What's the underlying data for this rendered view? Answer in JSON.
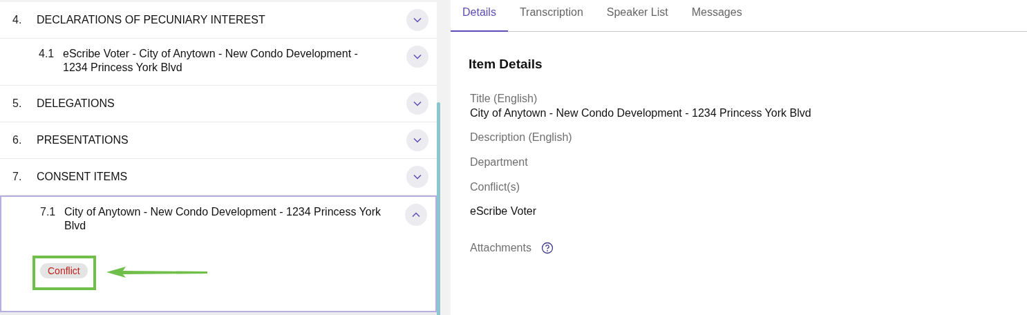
{
  "agenda": [
    {
      "number": "4.",
      "title": "DECLARATIONS OF PECUNIARY INTEREST",
      "expanded": false,
      "selected": false,
      "children": [
        {
          "number": "4.1",
          "title": "eScribe Voter - City of Anytown - New Condo Development - 1234 Princess York Blvd",
          "expanded": false,
          "selected": false
        }
      ]
    },
    {
      "number": "5.",
      "title": "DELEGATIONS",
      "expanded": false,
      "selected": false
    },
    {
      "number": "6.",
      "title": "PRESENTATIONS",
      "expanded": false,
      "selected": false
    },
    {
      "number": "7.",
      "title": "CONSENT ITEMS",
      "expanded": false,
      "selected": false,
      "children": [
        {
          "number": "7.1",
          "title": "City of Anytown - New Condo Development - 1234 Princess York Blvd",
          "expanded": true,
          "selected": true,
          "badge": "Conflict"
        }
      ]
    }
  ],
  "tabs": [
    {
      "label": "Details",
      "selected": true
    },
    {
      "label": "Transcription",
      "selected": false
    },
    {
      "label": "Speaker List",
      "selected": false
    },
    {
      "label": "Messages",
      "selected": false
    }
  ],
  "details": {
    "heading": "Item Details",
    "fields": [
      {
        "label": "Title (English)",
        "value": "City of Anytown - New Condo Development - 1234 Princess York Blvd"
      },
      {
        "label": "Description (English)"
      },
      {
        "label": "Department"
      },
      {
        "label": "Conflict(s)"
      },
      {
        "value": "eScribe Voter"
      },
      {
        "label": "Attachments",
        "help": true
      }
    ]
  }
}
